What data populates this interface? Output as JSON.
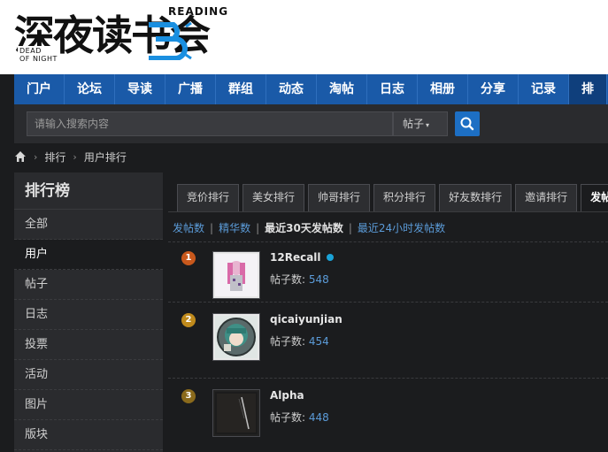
{
  "logo": {
    "title": "深夜读书会",
    "reading": "READING",
    "dead_of_night": "DEAD\nOF NIGHT"
  },
  "nav": {
    "items": [
      "门户",
      "论坛",
      "导读",
      "广播",
      "群组",
      "动态",
      "淘帖",
      "日志",
      "相册",
      "分享",
      "记录",
      "排"
    ]
  },
  "search": {
    "placeholder": "请输入搜索内容",
    "select_value": "帖子",
    "button_icon": "search-icon"
  },
  "breadcrumb": {
    "home_icon": "home-icon",
    "items": [
      "排行",
      "用户排行"
    ]
  },
  "sidebar": {
    "title": "排行榜",
    "items": [
      "全部",
      "用户",
      "帖子",
      "日志",
      "投票",
      "活动",
      "图片",
      "版块"
    ],
    "active_index": 1
  },
  "tabs": {
    "items": [
      "竞价排行",
      "美女排行",
      "帅哥排行",
      "积分排行",
      "好友数排行",
      "邀请排行",
      "发帖"
    ],
    "active_index": 6
  },
  "subtabs": {
    "items": [
      "发帖数",
      "精华数",
      "最近30天发帖数",
      "最近24小时发帖数"
    ],
    "current_index": 2
  },
  "ranking": {
    "count_label": "帖子数:",
    "rows": [
      {
        "rank": "1",
        "name": "12Recall",
        "online": true,
        "count": "548",
        "badge_color": "#c8581c"
      },
      {
        "rank": "2",
        "name": "qicaiyunjian",
        "online": false,
        "count": "454",
        "badge_color": "#c08a1c"
      },
      {
        "rank": "3",
        "name": "Alpha",
        "online": false,
        "count": "448",
        "badge_color": "#8a6a1c"
      }
    ]
  },
  "colors": {
    "nav_bg": "#1a5aa8",
    "link": "#5b9bd8",
    "search_button": "#1d6fc4",
    "online": "#1aa3d8"
  }
}
